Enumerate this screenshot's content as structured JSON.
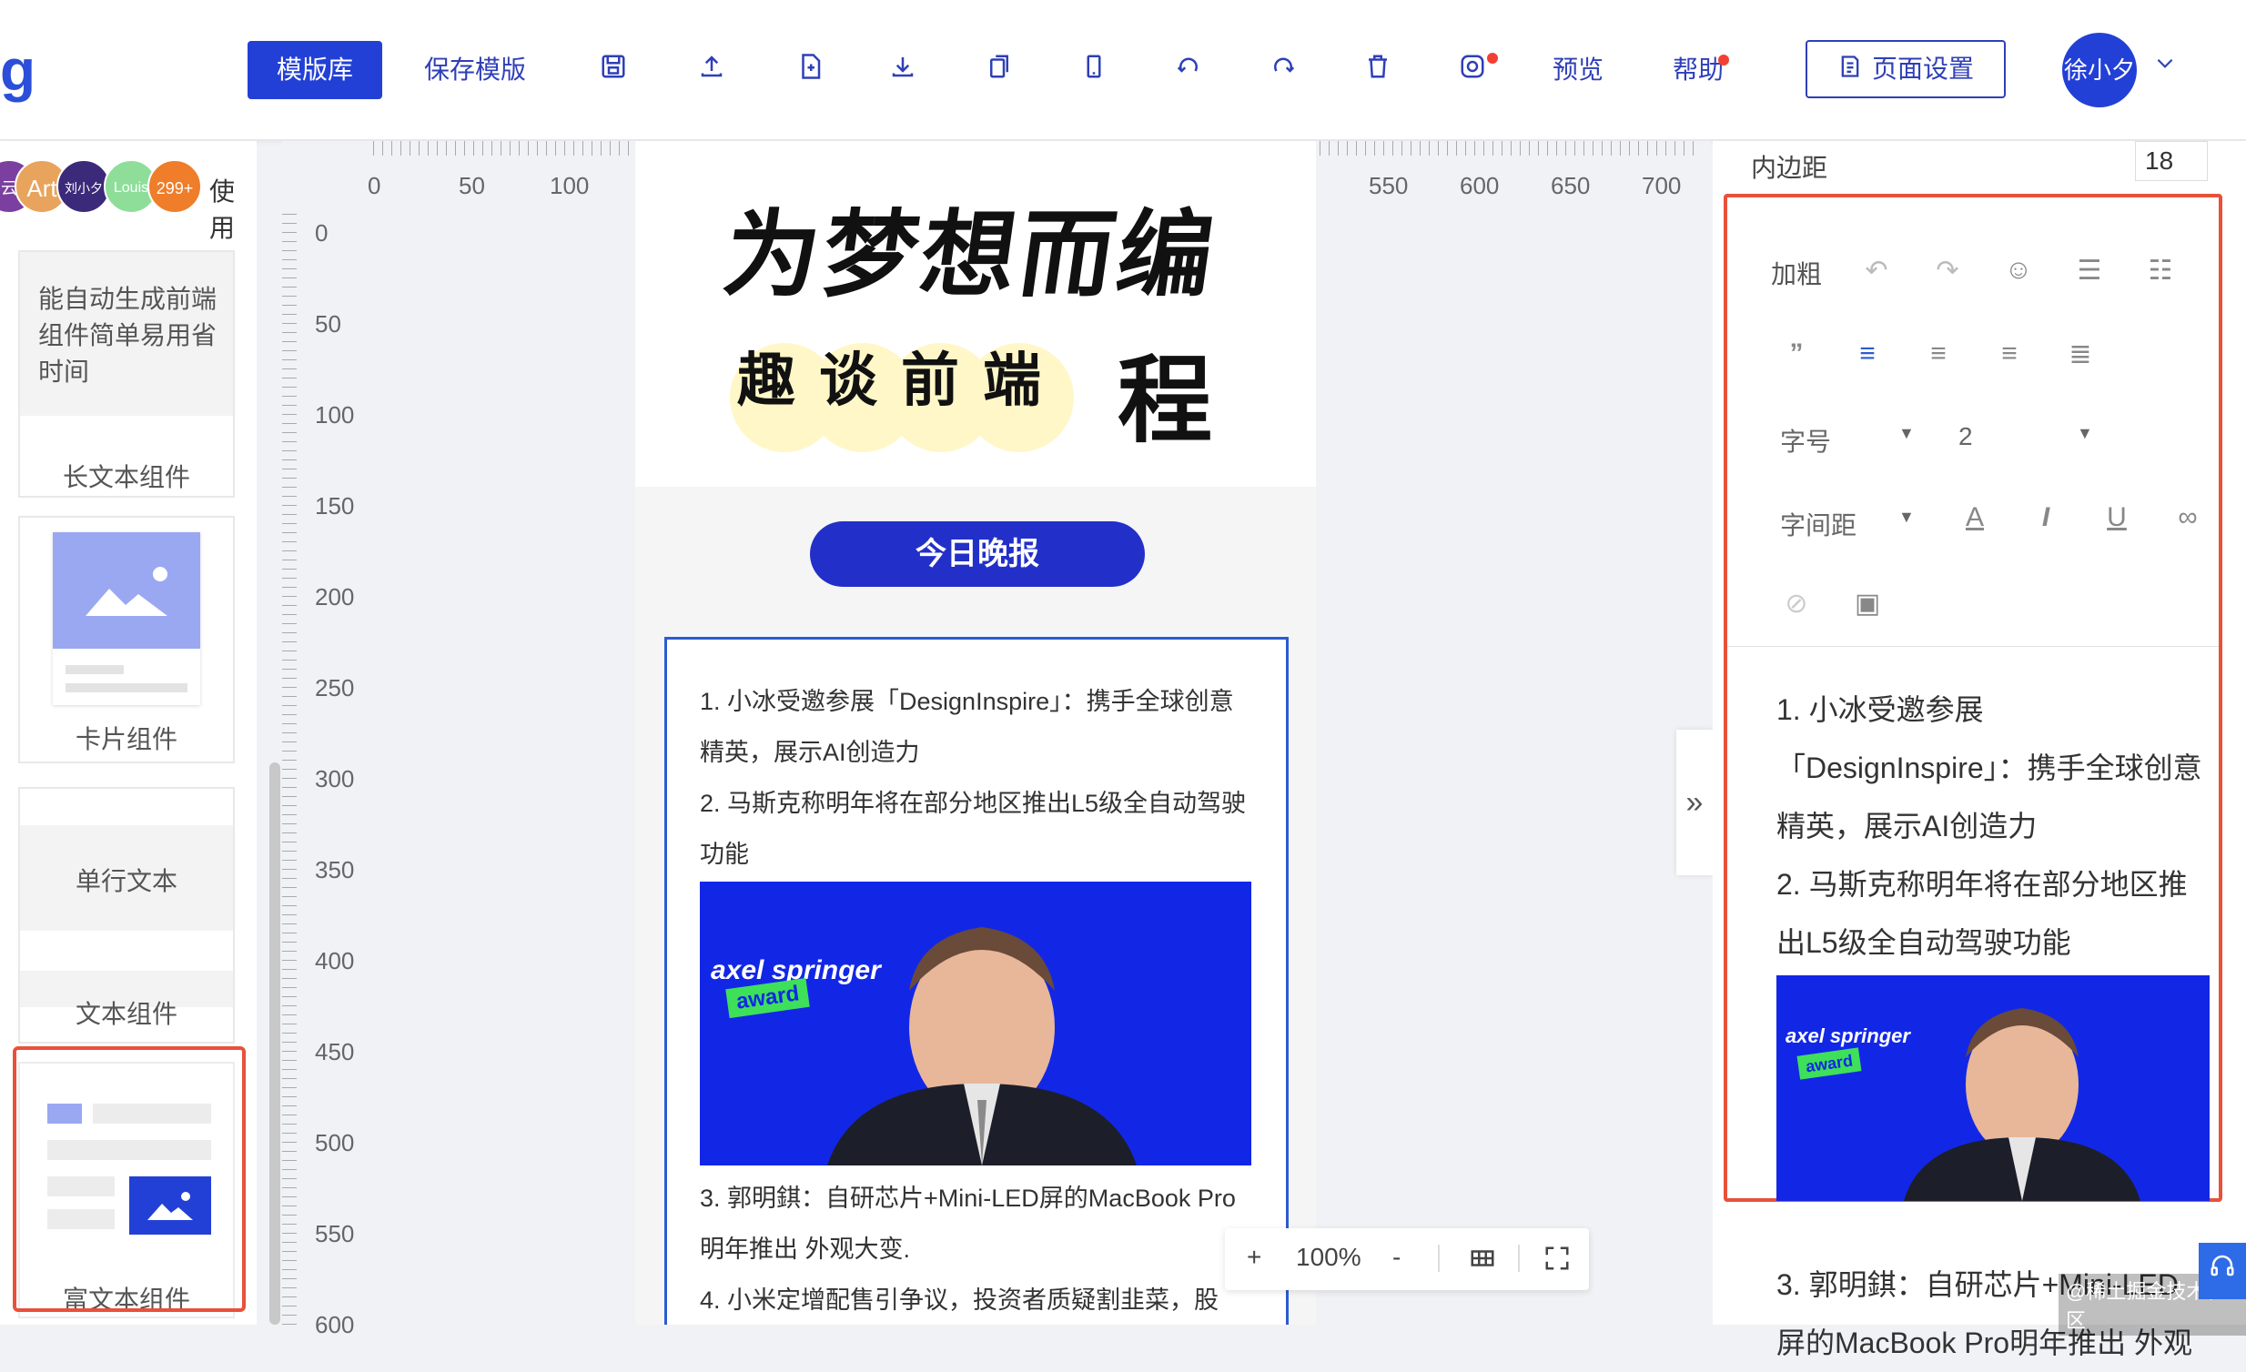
{
  "header": {
    "logo_text": "g",
    "template_library": "模版库",
    "save_template": "保存模版",
    "preview": "预览",
    "help": "帮助",
    "page_settings": "页面设置",
    "user_name": "徐小夕",
    "accent_color": "#2340d6"
  },
  "sidebar": {
    "users": [
      "云",
      "Art",
      "刘小夕",
      "Louis",
      "299+"
    ],
    "use_label": "使用",
    "cards": [
      {
        "label": "长文本组件",
        "preview_text": "能自动生成前端组件简单易用省时间"
      },
      {
        "label": "卡片组件"
      },
      {
        "label": "文本组件",
        "preview_text": "单行文本"
      },
      {
        "label": "富文本组件"
      }
    ]
  },
  "ruler": {
    "x_ticks": [
      "0",
      "50",
      "100",
      "550",
      "600",
      "650",
      "700"
    ],
    "y_ticks": [
      "0",
      "50",
      "100",
      "150",
      "200",
      "250",
      "300",
      "350",
      "400",
      "450",
      "500",
      "550",
      "600"
    ]
  },
  "canvas": {
    "banner_line1": "为梦想而编",
    "banner_line2": "趣谈前端",
    "banner_line2_tail": "程",
    "pill_button": "今日晚报",
    "news": [
      "1. 小冰受邀参展「DesignInspire」：携手全球创意精英，展示AI创造力",
      "2. 马斯克称明年将在部分地区推出L5级全自动驾驶功能",
      "3. 郭明錤：自研芯片+Mini-LED屏的MacBook Pro明年推出 外观大变.",
      "4. 小米定增配售引争议，投资者质疑割韭菜，股"
    ],
    "photo_title": "axel springer",
    "photo_badge": "award"
  },
  "zoom": {
    "plus": "+",
    "value": "100%",
    "minus": "-"
  },
  "right_panel": {
    "padding_label": "内边距",
    "padding_value": "18",
    "bold": "加粗",
    "font_size_label": "字号",
    "font_size_value": "2",
    "letter_spacing_label": "字间距",
    "content": [
      "1. 小冰受邀参展「DesignInspire」：携手全球创意精英，展示AI创造力",
      "2. 马斯克称明年将在部分地区推出L5级全自动驾驶功能",
      "3. 郭明錤：自研芯片+Mini-LED屏的MacBook Pro明年推出 外观"
    ],
    "photo_title": "axel springer",
    "photo_badge": "award",
    "highlight_color": "#e8513a"
  },
  "watermark": "@稀土掘金技术社区"
}
